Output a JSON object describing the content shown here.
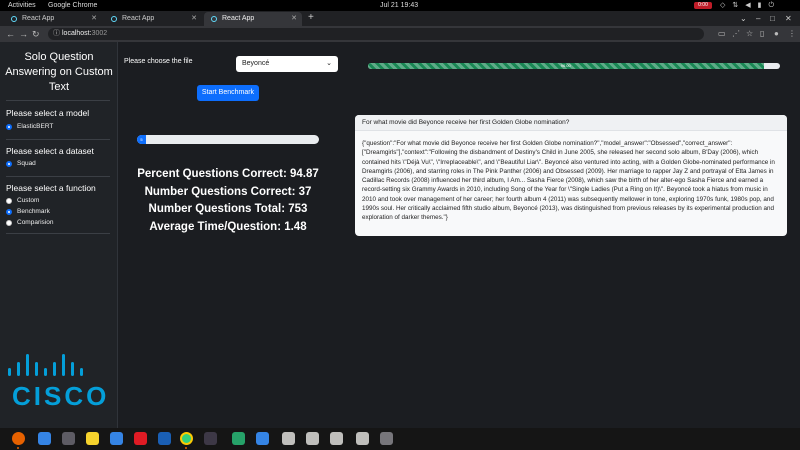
{
  "os_bar": {
    "activities": "Activities",
    "app_name": "Google Chrome",
    "clock": "Jul 21  19:43",
    "rec_timer": "0:00"
  },
  "browser": {
    "tabs": [
      {
        "title": "React App",
        "active": false
      },
      {
        "title": "React App",
        "active": false
      },
      {
        "title": "React App",
        "active": true
      }
    ],
    "url_host": "localhost:",
    "url_port": "3002"
  },
  "sidebar": {
    "title": "Solo Question Answering on Custom Text",
    "model_heading": "Please select a model",
    "models": [
      {
        "label": "ElasticBERT",
        "checked": true
      }
    ],
    "dataset_heading": "Please select a dataset",
    "datasets": [
      {
        "label": "Squad",
        "checked": true
      }
    ],
    "function_heading": "Please select a function",
    "functions": [
      {
        "label": "Custom",
        "checked": false
      },
      {
        "label": "Benchmark",
        "checked": true
      },
      {
        "label": "Comparision",
        "checked": false
      }
    ],
    "logo_text": "CISCO"
  },
  "file_picker": {
    "label": "Please choose the file",
    "selected": "Beyoncé"
  },
  "benchmark_button": "Start Benchmark",
  "progress": {
    "top_fraction": 0.96,
    "top_label": "96.00",
    "left_fraction": 0.05,
    "left_label": "5"
  },
  "stats": {
    "percent_correct": "Percent Questions Correct: 94.87",
    "number_correct": "Number Questions Correct: 37",
    "number_total": "Number Questions Total: 753",
    "avg_time": "Average Time/Question: 1.48"
  },
  "result_card": {
    "header": "For what movie did Beyonce receive her first Golden Globe nomination?",
    "body": "{\"question\":\"For what movie did Beyonce receive her first Golden Globe nomination?\",\"model_answer\":\"Obsessed\",\"correct_answer\":[\"Dreamgirls\"],\"context\":\"Following the disbandment of Destiny's Child in June 2005, she released her second solo album, B'Day (2006), which contained hits \\\"Déjà Vu\\\", \\\"Irreplaceable\\\", and \\\"Beautiful Liar\\\". Beyoncé also ventured into acting, with a Golden Globe-nominated performance in Dreamgirls (2006), and starring roles in The Pink Panther (2006) and Obsessed (2009). Her marriage to rapper Jay Z and portrayal of Etta James in Cadillac Records (2008) influenced her third album, I Am... Sasha Fierce (2008), which saw the birth of her alter-ego Sasha Fierce and earned a record-setting six Grammy Awards in 2010, including Song of the Year for \\\"Single Ladies (Put a Ring on It)\\\". Beyoncé took a hiatus from music in 2010 and took over management of her career; her fourth album 4 (2011) was subsequently mellower in tone, exploring 1970s funk, 1980s pop, and 1990s soul. Her critically acclaimed fifth studio album, Beyoncé (2013), was distinguished from previous releases by its experimental production and exploration of darker themes.\"}"
  },
  "colors": {
    "page_bg": "#1b1d21",
    "sidebar_bg": "#202327",
    "primary": "#0d6efd",
    "success": "#198754",
    "cisco_blue": "#049fd9"
  },
  "dock_apps": [
    "firefox-icon",
    "thunderbird-icon",
    "files-icon",
    "rhythmbox-icon",
    "writer-icon",
    "software-icon",
    "help-icon",
    "chrome-icon",
    "terminal-icon",
    "vscode-insiders-icon",
    "vscode-icon",
    "doc-icon",
    "doc-icon",
    "doc-icon",
    "doc-icon",
    "trash-icon"
  ]
}
